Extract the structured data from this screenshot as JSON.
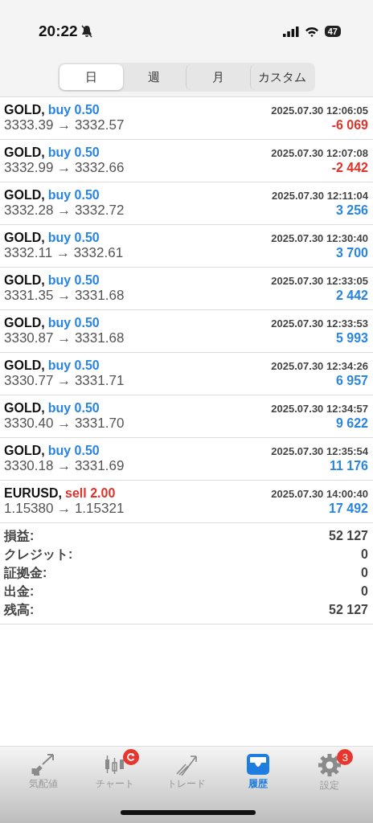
{
  "status_bar": {
    "time": "20:22",
    "battery": "47"
  },
  "period_tabs": [
    {
      "label": "日",
      "selected": true
    },
    {
      "label": "週",
      "selected": false
    },
    {
      "label": "月",
      "selected": false
    },
    {
      "label": "カスタム",
      "selected": false
    }
  ],
  "trades": [
    {
      "symbol": "GOLD,",
      "kind": "buy",
      "side_label": "buy 0.50",
      "time": "2025.07.30 12:06:05",
      "prices": "3333.39 → 3332.57",
      "profit": "-6 069",
      "loss": true
    },
    {
      "symbol": "GOLD,",
      "kind": "buy",
      "side_label": "buy 0.50",
      "time": "2025.07.30 12:07:08",
      "prices": "3332.99 → 3332.66",
      "profit": "-2 442",
      "loss": true
    },
    {
      "symbol": "GOLD,",
      "kind": "buy",
      "side_label": "buy 0.50",
      "time": "2025.07.30 12:11:04",
      "prices": "3332.28 → 3332.72",
      "profit": "3 256",
      "loss": false
    },
    {
      "symbol": "GOLD,",
      "kind": "buy",
      "side_label": "buy 0.50",
      "time": "2025.07.30 12:30:40",
      "prices": "3332.11 → 3332.61",
      "profit": "3 700",
      "loss": false
    },
    {
      "symbol": "GOLD,",
      "kind": "buy",
      "side_label": "buy 0.50",
      "time": "2025.07.30 12:33:05",
      "prices": "3331.35 → 3331.68",
      "profit": "2 442",
      "loss": false
    },
    {
      "symbol": "GOLD,",
      "kind": "buy",
      "side_label": "buy 0.50",
      "time": "2025.07.30 12:33:53",
      "prices": "3330.87 → 3331.68",
      "profit": "5 993",
      "loss": false
    },
    {
      "symbol": "GOLD,",
      "kind": "buy",
      "side_label": "buy 0.50",
      "time": "2025.07.30 12:34:26",
      "prices": "3330.77 → 3331.71",
      "profit": "6 957",
      "loss": false
    },
    {
      "symbol": "GOLD,",
      "kind": "buy",
      "side_label": "buy 0.50",
      "time": "2025.07.30 12:34:57",
      "prices": "3330.40 → 3331.70",
      "profit": "9 622",
      "loss": false
    },
    {
      "symbol": "GOLD,",
      "kind": "buy",
      "side_label": "buy 0.50",
      "time": "2025.07.30 12:35:54",
      "prices": "3330.18 → 3331.69",
      "profit": "11 176",
      "loss": false
    },
    {
      "symbol": "EURUSD,",
      "kind": "sell",
      "side_label": "sell 2.00",
      "time": "2025.07.30 14:00:40",
      "prices": "1.15380 → 1.15321",
      "profit": "17 492",
      "loss": false
    }
  ],
  "summary": [
    {
      "label": "損益:",
      "value": "52 127"
    },
    {
      "label": "クレジット:",
      "value": "0"
    },
    {
      "label": "証拠金:",
      "value": "0"
    },
    {
      "label": "出金:",
      "value": "0"
    },
    {
      "label": "残高:",
      "value": "52 127"
    }
  ],
  "tab_bar": [
    {
      "kind": "quotes",
      "label": "気配値",
      "selected": false
    },
    {
      "kind": "chart",
      "label": "チャート",
      "selected": false,
      "refresh_badge": true
    },
    {
      "kind": "trade",
      "label": "トレード",
      "selected": false
    },
    {
      "kind": "history",
      "label": "履歴",
      "selected": true
    },
    {
      "kind": "settings",
      "label": "設定",
      "selected": false,
      "badge": "3"
    }
  ]
}
